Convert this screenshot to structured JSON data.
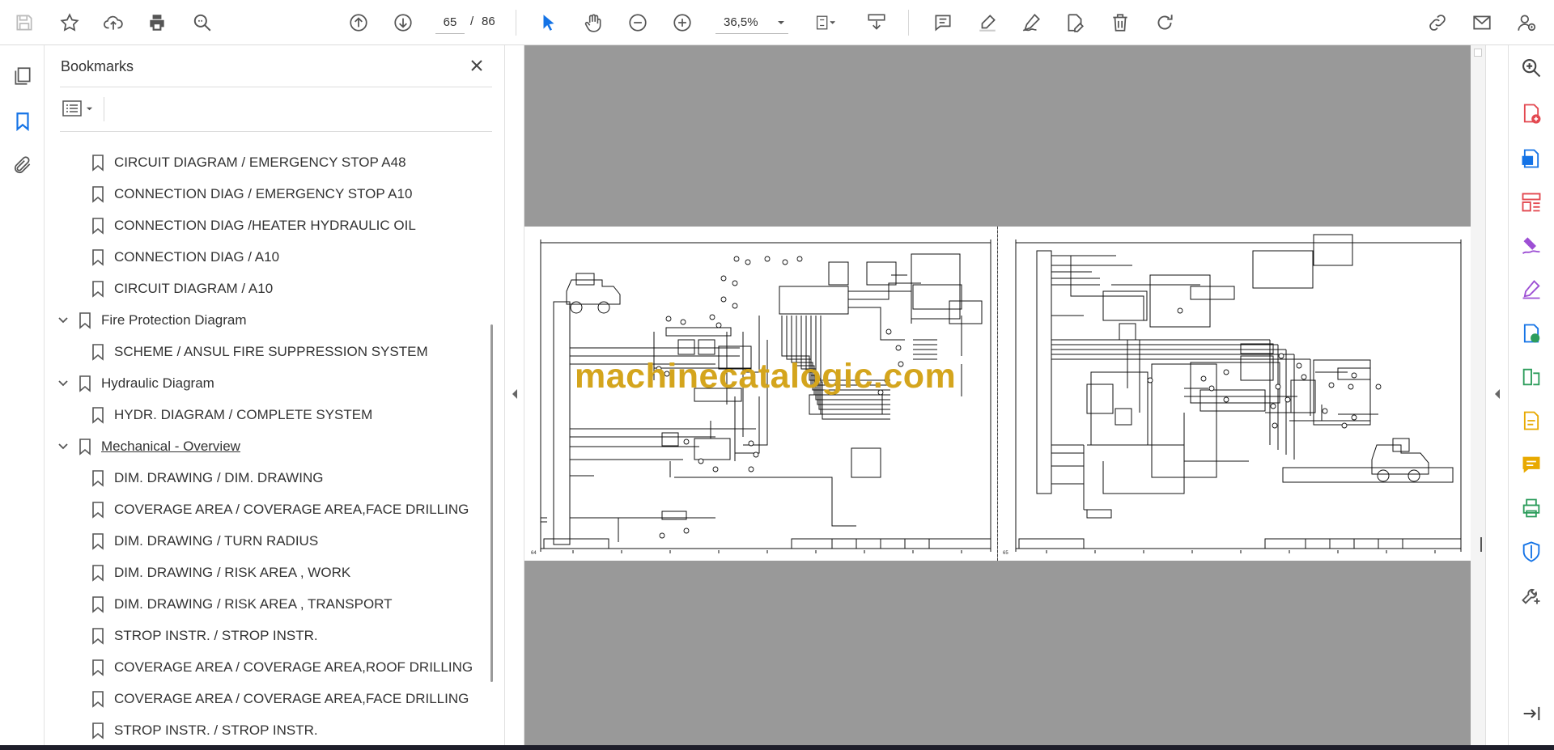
{
  "toolbar": {
    "page_current": "65",
    "page_sep": "/",
    "page_total": "86",
    "zoom": "36,5%",
    "icons": [
      "save-icon",
      "star-icon",
      "upload-icon",
      "print-icon",
      "search-zoom-icon",
      "page-up-icon",
      "page-down-icon",
      "zoom-out-icon",
      "zoom-in-icon",
      "select-cursor-icon",
      "hand-icon",
      "fit-page-icon",
      "scroll-mode-icon",
      "comment-icon",
      "highlight-icon",
      "sign-pen-icon",
      "edit-pdf-icon",
      "delete-icon",
      "rotate-icon",
      "share-link-icon",
      "mail-icon",
      "account-icon"
    ]
  },
  "left_rail": {
    "icons": [
      "pages-thumbnail-icon",
      "bookmark-icon",
      "attachment-icon"
    ]
  },
  "bookmarks": {
    "title": "Bookmarks",
    "items": [
      {
        "label": "CIRCUIT DIAGRAM / EMERGENCY STOP A48",
        "level": 2
      },
      {
        "label": "CONNECTION DIAG / EMERGENCY STOP A10",
        "level": 2
      },
      {
        "label": "CONNECTION DIAG /HEATER HYDRAULIC OIL",
        "level": 2
      },
      {
        "label": "CONNECTION DIAG / A10",
        "level": 2
      },
      {
        "label": "CIRCUIT DIAGRAM / A10",
        "level": 2
      },
      {
        "label": "Fire Protection Diagram",
        "level": 1
      },
      {
        "label": "SCHEME / ANSUL FIRE SUPPRESSION SYSTEM",
        "level": 2
      },
      {
        "label": "Hydraulic Diagram",
        "level": 1
      },
      {
        "label": "HYDR. DIAGRAM / COMPLETE SYSTEM",
        "level": 2
      },
      {
        "label": "Mechanical - Overview",
        "level": 1
      },
      {
        "label": "DIM. DRAWING / DIM. DRAWING",
        "level": 2
      },
      {
        "label": "COVERAGE AREA / COVERAGE AREA,FACE DRILLING",
        "level": 2
      },
      {
        "label": "DIM. DRAWING / TURN RADIUS",
        "level": 2
      },
      {
        "label": "DIM. DRAWING / RISK AREA , WORK",
        "level": 2
      },
      {
        "label": "DIM. DRAWING / RISK AREA , TRANSPORT",
        "level": 2
      },
      {
        "label": "STROP INSTR. / STROP INSTR.",
        "level": 2
      },
      {
        "label": "COVERAGE AREA / COVERAGE AREA,ROOF DRILLING",
        "level": 2
      },
      {
        "label": "COVERAGE AREA / COVERAGE AREA,FACE DRILLING",
        "level": 2
      },
      {
        "label": "STROP INSTR. / STROP INSTR.",
        "level": 2
      }
    ]
  },
  "document": {
    "watermark": "machinecatalogic.com",
    "left_page_number": "64",
    "right_page_number": "65"
  },
  "right_rail": {
    "icons": [
      "zoom-search-icon",
      "create-pdf-icon",
      "export-pdf-icon",
      "organize-pages-icon",
      "request-sign-icon",
      "fill-sign-icon",
      "share-pdf-icon",
      "compress-icon",
      "edit-text-icon",
      "comment-tool-icon",
      "print-production-icon",
      "protect-icon",
      "more-tools-icon",
      "collapse-right-icon"
    ]
  },
  "colors": {
    "accent_blue": "#1473e6",
    "watermark": "#d4a51d",
    "doc_bg": "#999999",
    "tool_red": "#e34850",
    "tool_purple": "#9d4fd4",
    "tool_green": "#2d9d5c",
    "tool_yellow": "#e8a900"
  }
}
